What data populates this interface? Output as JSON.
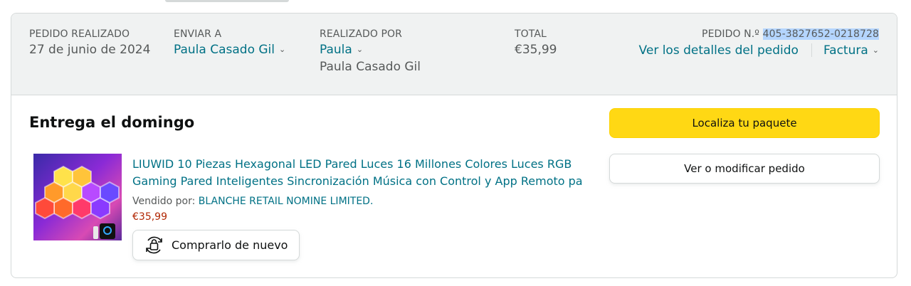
{
  "header": {
    "order_placed_label": "PEDIDO REALIZADO",
    "order_placed_value": "27 de junio de 2024",
    "ship_to_label": "ENVIAR A",
    "ship_to_value": "Paula Casado Gil",
    "placed_by_label": "REALIZADO POR",
    "placed_by_value": "Paula",
    "placed_by_sub": "Paula Casado Gil",
    "total_label": "TOTAL",
    "total_value": "€35,99",
    "order_number_label": "PEDIDO N.º",
    "order_number_value": "405-3827652-0218728",
    "order_details_link": "Ver los detalles del pedido",
    "invoice_link": "Factura"
  },
  "delivery": {
    "title": "Entrega el domingo"
  },
  "product": {
    "title": "LIUWID 10 Piezas Hexagonal LED Pared Luces 16 Millones Colores Luces RGB Gaming Pared Inteligentes Sincronización Música con Control y App Remoto pa",
    "seller_label": "Vendido por:",
    "seller_name": "BLANCHE RETAIL NOMINE LIMITED.",
    "price": "€35,99",
    "buy_again_label": "Comprarlo de nuevo"
  },
  "actions": {
    "track_label": "Localiza tu paquete",
    "modify_label": "Ver o modificar pedido"
  },
  "icons": {
    "chevron": "chevron-down-icon",
    "buy_again": "buy-again-icon"
  },
  "colors": {
    "link": "#007185",
    "price": "#b12704",
    "primary_button": "#ffd814",
    "header_bg": "#f0f2f2",
    "highlight": "#b4d5fe"
  }
}
